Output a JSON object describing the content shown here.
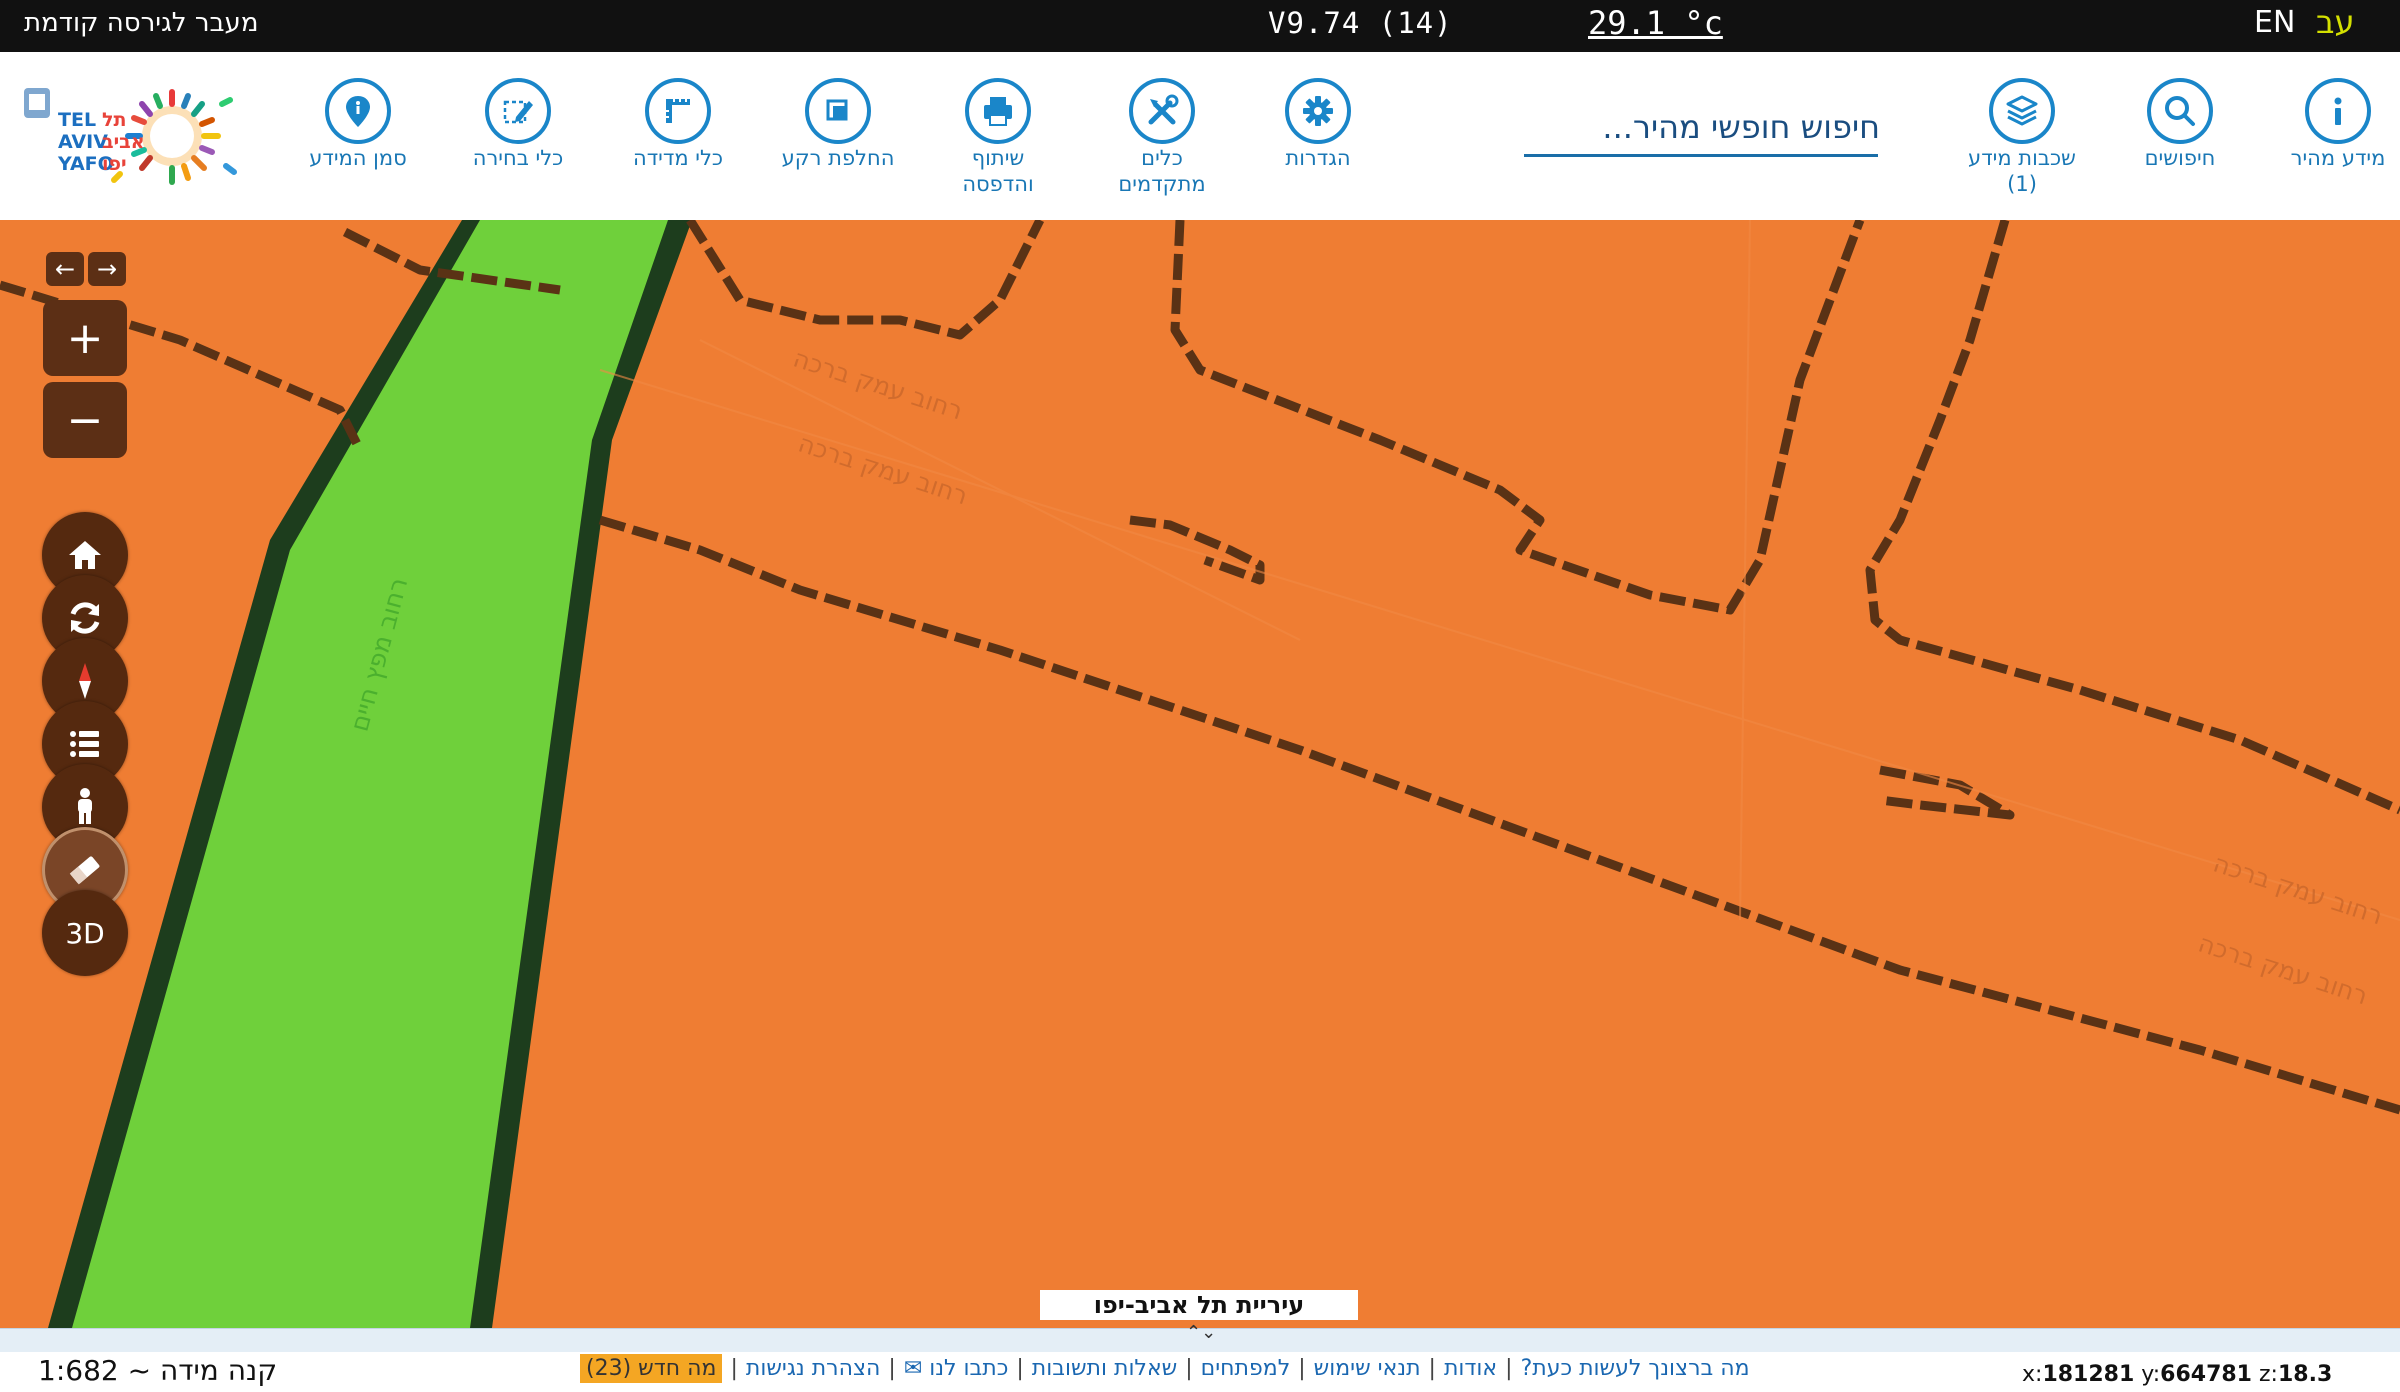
{
  "top_bar": {
    "prev_version": "מעבר לגירסה קודמת",
    "version": "V9.74 (14)",
    "temperature": "29.1 °c",
    "lang_en": "EN",
    "lang_he": "עב"
  },
  "toolbar": {
    "tools": {
      "quick_info": "מידע מהיר",
      "searches": "חיפושים",
      "info_layers_line1": "שכבות מידע",
      "info_layers_line2": "(1)",
      "settings": "הגדרות",
      "advanced_line1": "כלים",
      "advanced_line2": "מתקדמים",
      "share_line1": "שיתוף",
      "share_line2": "והדפסה",
      "basemap": "החלפת רקע",
      "measure": "כלי מדידה",
      "select": "כלי בחירה",
      "info_marker": "סמן המידע"
    },
    "search_placeholder": "חיפוש חופשי מהיר..."
  },
  "logo": {
    "text_en_1": "TEL",
    "text_en_2": "AVIV",
    "text_en_3": "YAFO",
    "text_he_1": "תל",
    "text_he_2": "אביב",
    "text_he_3": "יפו"
  },
  "map": {
    "colors": {
      "land": "#ef7d33",
      "park": "#6fd03b",
      "park_border": "#1d3d1d",
      "lines": "#5a3215"
    },
    "street_labels": {
      "s1": "רחוב עמק ברכה",
      "s2": "רחוב עמק ברכה",
      "s3": "רחוב מפץ חיים",
      "s4": "רחוב עמק ברכה",
      "s5": "רחוב עמק ברכה"
    },
    "controls": {
      "back": "←",
      "forward": "→",
      "zoom_in": "+",
      "zoom_out": "−",
      "three_d": "3D"
    },
    "city_label": "עיריית תל אביב-יפו"
  },
  "footer": {
    "handle_arrows": "⌃⌄",
    "scale": "קנה מידה ~ 1:682",
    "links": {
      "what_now": "מה ברצונך לעשות כעת?",
      "about": "אודות",
      "terms": "תנאי שימוש",
      "developers": "למפתחים",
      "faq": "שאלות ותשובות",
      "contact": "כתבו לנו ✉",
      "accessibility": "הצהרת נגישות",
      "whats_new": "מה חדש (23)"
    },
    "coords": {
      "x_label": "x:",
      "x": "181281",
      "y_label": "y:",
      "y": "664781",
      "z_label": "z:",
      "z": "18.3"
    }
  }
}
